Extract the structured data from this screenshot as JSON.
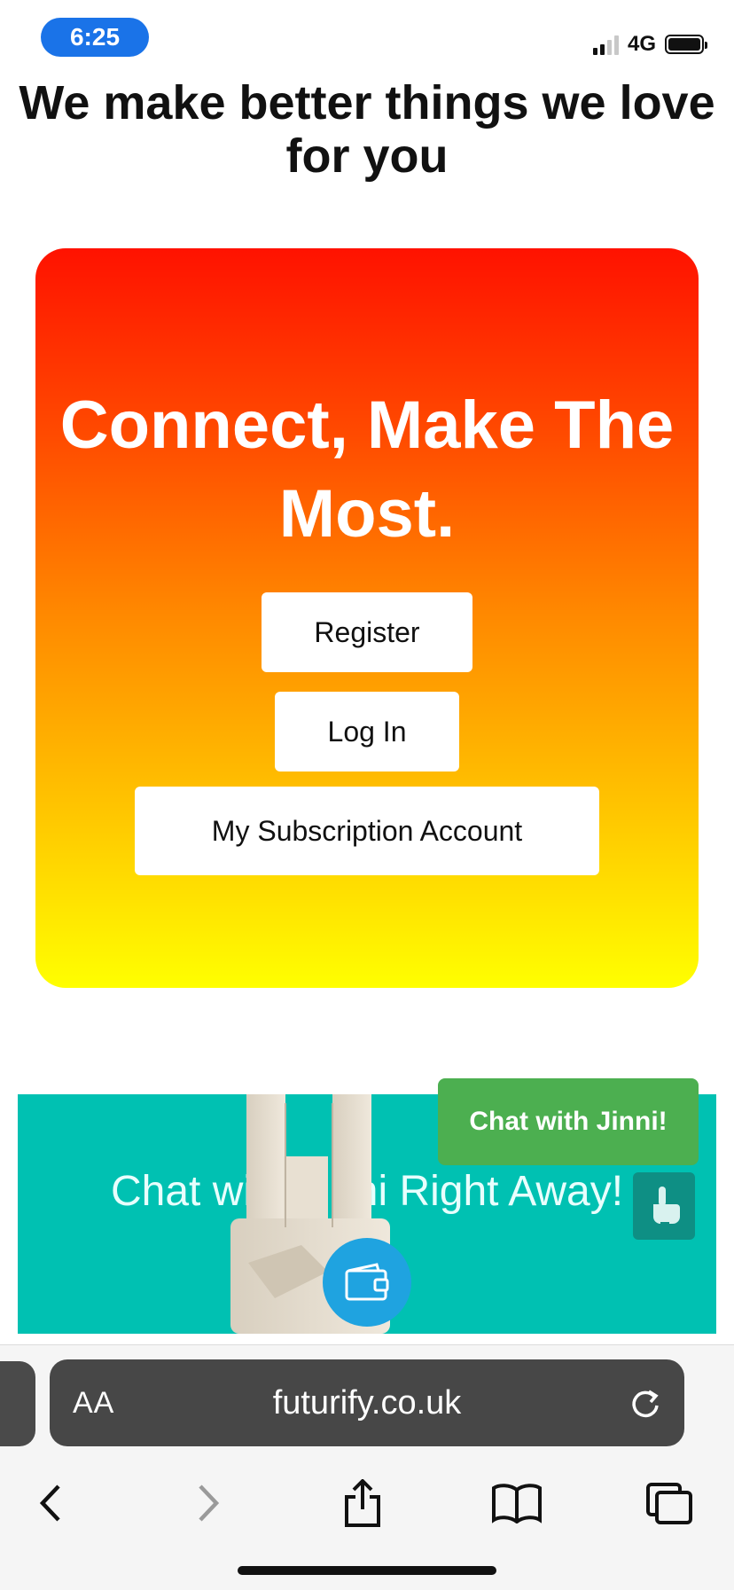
{
  "status_bar": {
    "time": "6:25",
    "network": "4G"
  },
  "page": {
    "headline": "We make better things we love for you"
  },
  "hero": {
    "title": "Connect, Make The Most.",
    "buttons": {
      "register": "Register",
      "login": "Log In",
      "subscription": "My Subscription Account"
    },
    "gradient": [
      "#ff1200",
      "#ffff00"
    ]
  },
  "promo": {
    "text": "Chat with Jinni Right Away!",
    "chat_button": "Chat with Jinni!",
    "background": "#00c1b2"
  },
  "browser": {
    "aa_label": "AA",
    "url": "futurify.co.uk",
    "icons": [
      "back-icon",
      "forward-icon",
      "share-icon",
      "bookmarks-icon",
      "tabs-icon",
      "reload-icon"
    ]
  }
}
